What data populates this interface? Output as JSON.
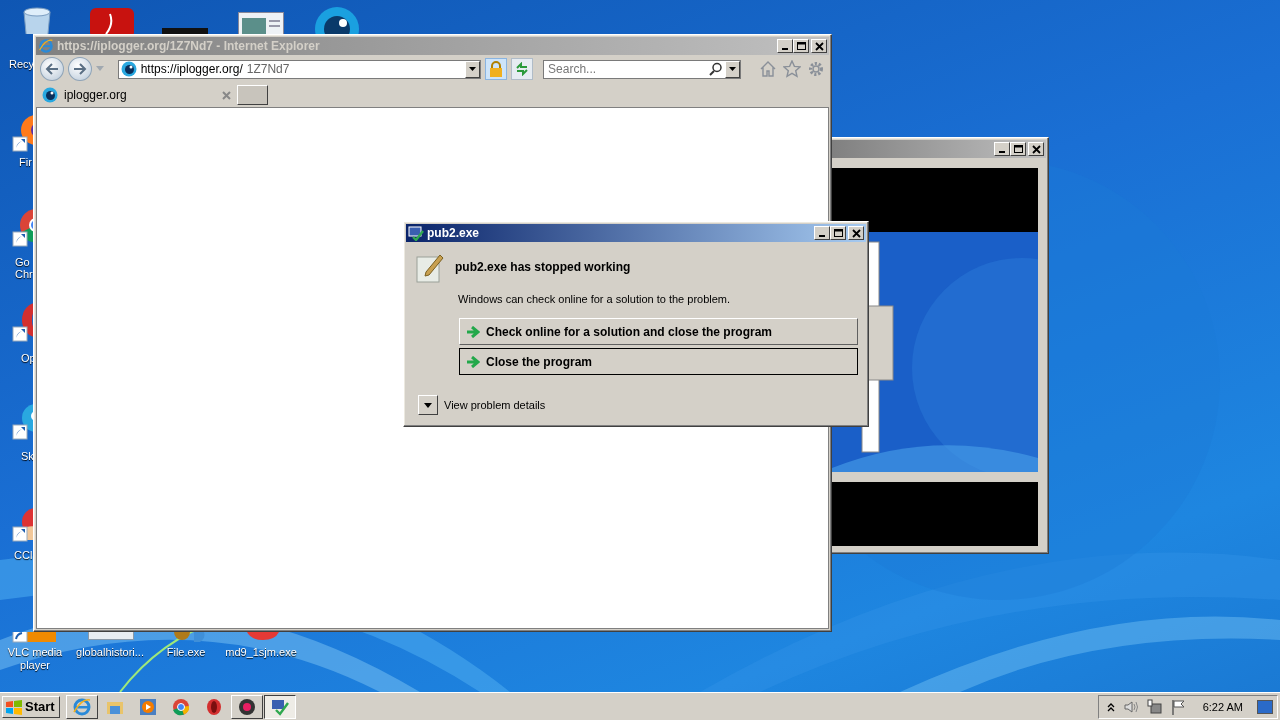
{
  "desktop_icons": [
    {
      "label": "Recy"
    },
    {
      "label": "Fir"
    },
    {
      "label": "Go Chr"
    },
    {
      "label": "Op"
    },
    {
      "label": "Sk"
    },
    {
      "label": "CCl"
    }
  ],
  "bottom_icons": [
    {
      "label": "VLC media player"
    },
    {
      "label": "globalhistori..."
    },
    {
      "label": "File.exe"
    },
    {
      "label": "md9_1sjm.exe"
    }
  ],
  "browser": {
    "title": "https://iplogger.org/1Z7Nd7 - Internet Explorer",
    "address": {
      "host": "https://iplogger.org/",
      "path": "1Z7Nd7"
    },
    "search": {
      "placeholder": "Search..."
    },
    "tabs": [
      {
        "label": "iplogger.org",
        "selected": true
      }
    ]
  },
  "dialog": {
    "title": "pub2.exe",
    "heading": "pub2.exe has stopped working",
    "message": "Windows can check online for a solution to the problem.",
    "options": [
      {
        "label": "Check online for a solution and close the program",
        "selected": false
      },
      {
        "label": "Close the program",
        "selected": true
      }
    ],
    "details": "View problem details"
  },
  "taskbar": {
    "start": "Start",
    "buttons": [
      {
        "kind": "browser",
        "open": true,
        "selected": false
      },
      {
        "kind": "folder",
        "open": false,
        "selected": false
      },
      {
        "kind": "player",
        "open": false,
        "selected": false
      },
      {
        "kind": "chrome",
        "open": false,
        "selected": false
      },
      {
        "kind": "opera",
        "open": false,
        "selected": false
      },
      {
        "kind": "recorder",
        "open": true,
        "selected": false
      },
      {
        "kind": "app",
        "open": true,
        "selected": true
      }
    ],
    "clock": "6:22 AM"
  }
}
